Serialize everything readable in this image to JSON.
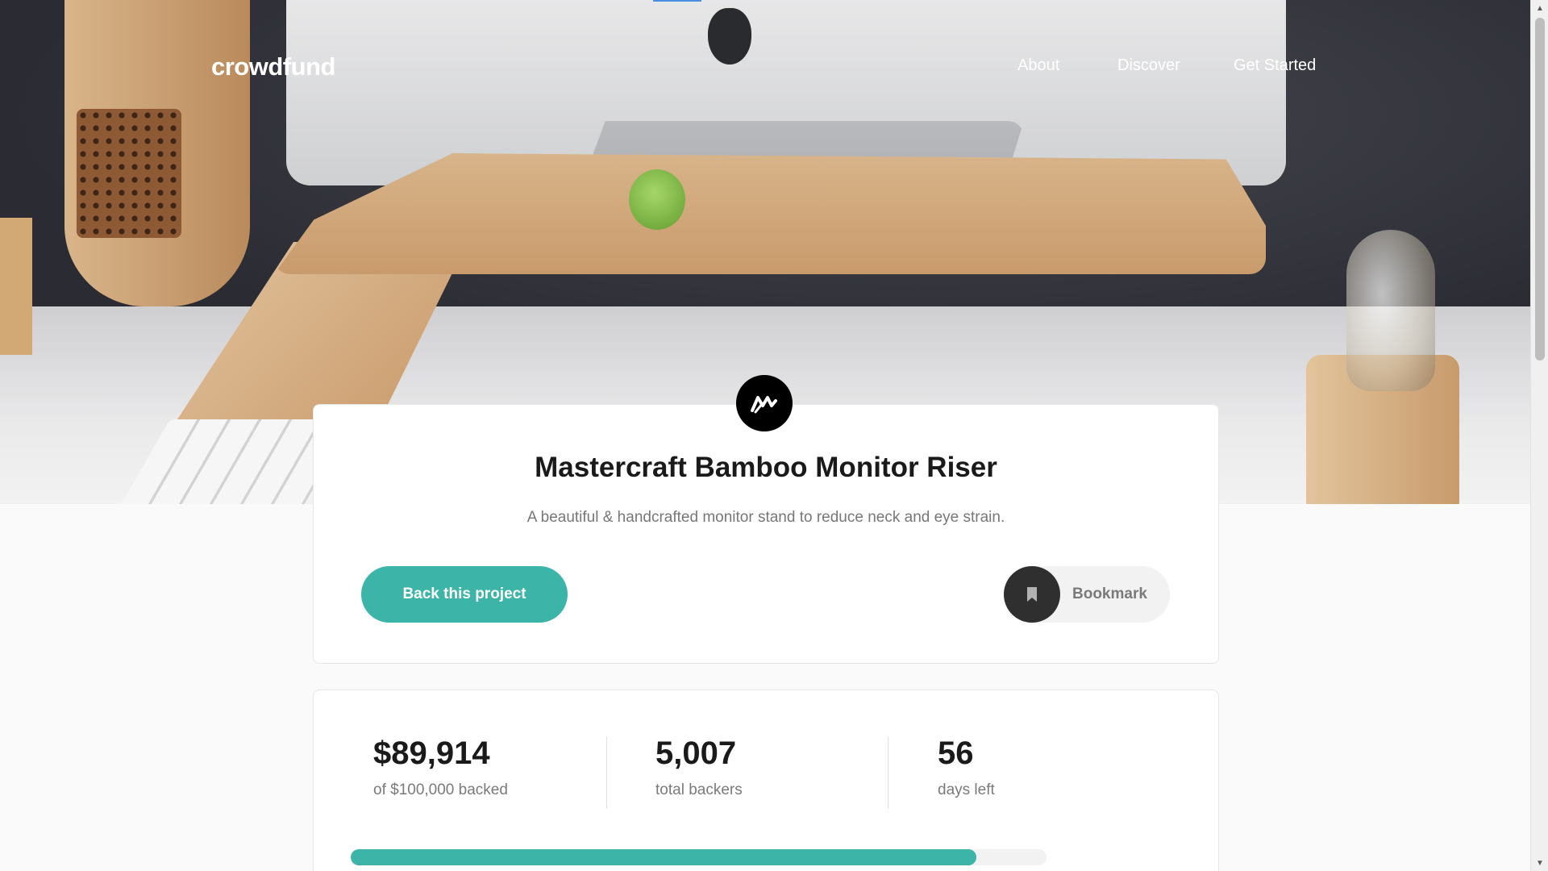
{
  "header": {
    "logo": "crowdfund",
    "nav": [
      "About",
      "Discover",
      "Get Started"
    ]
  },
  "project": {
    "title": "Mastercraft Bamboo Monitor Riser",
    "description": "A beautiful & handcrafted monitor stand to reduce neck and eye strain.",
    "back_label": "Back this project",
    "bookmark_label": "Bookmark"
  },
  "stats": {
    "backed_value": "$89,914",
    "backed_label": "of $100,000 backed",
    "backers_value": "5,007",
    "backers_label": "total backers",
    "days_value": "56",
    "days_label": "days left",
    "progress_fraction": 0.8991
  },
  "colors": {
    "accent": "#3cb4a7",
    "dark": "#2f2f2f",
    "text_dark": "#1a1a1a",
    "text_gray": "#7a7a7a"
  },
  "icons": {
    "brand": "mastercraft-logo-icon",
    "bookmark": "bookmark-icon",
    "scroll_up": "arrow-up-icon",
    "scroll_down": "arrow-down-icon"
  }
}
